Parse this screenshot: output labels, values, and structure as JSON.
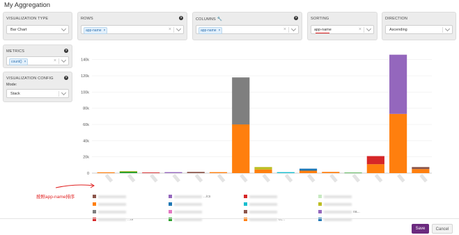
{
  "page": {
    "title": "My Aggregation"
  },
  "viz_type": {
    "label": "VISUALIZATION TYPE",
    "value": "Bar Chart"
  },
  "rows": {
    "label": "ROWS",
    "tag": "app-name"
  },
  "columns": {
    "label": "COLUMNS",
    "tag": "app-name"
  },
  "sorting": {
    "label": "SORTING",
    "value": "app-name"
  },
  "direction": {
    "label": "DIRECTION",
    "value": "Ascending"
  },
  "metrics": {
    "label": "METRICS",
    "tag": "count()"
  },
  "viz_config": {
    "label": "VISUALIZATION CONFIG",
    "mode_label": "Mode:",
    "mode_value": "Stack"
  },
  "annotation": "按照app-name排序",
  "buttons": {
    "save": "Save",
    "cancel": "Cancel"
  },
  "colors": {
    "orange": "#ff7f0e",
    "gray": "#7f7f7f",
    "purple": "#9467bd",
    "red": "#d62728",
    "green": "#2ca02c",
    "blue": "#1f77b4",
    "brown": "#8c564b",
    "olive": "#bcbd22",
    "save": "#6b2a7e",
    "annotation": "#e02020"
  },
  "legend": {
    "items": [
      {
        "color": "#8c564b",
        "text": ""
      },
      {
        "color": "#9467bd",
        "text": "...ics"
      },
      {
        "color": "#d62728",
        "text": ""
      },
      {
        "color": "#c7e9c0",
        "text": ""
      },
      {
        "color": "#ff7f0e",
        "text": ""
      },
      {
        "color": "#1f77b4",
        "text": ""
      },
      {
        "color": "#17becf",
        "text": ""
      },
      {
        "color": "#bcbd22",
        "text": ""
      },
      {
        "color": "#7f7f7f",
        "text": ""
      },
      {
        "color": "#e377c2",
        "text": ""
      },
      {
        "color": "#8c564b",
        "text": ""
      },
      {
        "color": "#9467bd",
        "text": "oa..."
      },
      {
        "color": "#d62728",
        "text": "...or"
      },
      {
        "color": "#2ca02c",
        "text": ""
      },
      {
        "color": "#ff7f0e",
        "text": "cc..."
      },
      {
        "color": "#1f77b4",
        "text": ""
      }
    ]
  },
  "chart_data": {
    "type": "bar",
    "stacked": true,
    "ylim": [
      0,
      150000
    ],
    "yticks": [
      0,
      20000,
      40000,
      60000,
      80000,
      100000,
      120000,
      140000
    ],
    "ytick_labels": [
      "0",
      "20k",
      "40k",
      "60k",
      "80k",
      "100k",
      "120k",
      "140k"
    ],
    "grid": true,
    "bars": [
      [
        {
          "c": "#ff7f0e",
          "v": 1000
        }
      ],
      [
        {
          "c": "#2ca02c",
          "v": 1800
        },
        {
          "c": "#bcbd22",
          "v": 600
        }
      ],
      [
        {
          "c": "#d62728",
          "v": 800
        }
      ],
      [
        {
          "c": "#9467bd",
          "v": 1200
        }
      ],
      [
        {
          "c": "#8c564b",
          "v": 1500
        }
      ],
      [
        {
          "c": "#ff7f0e",
          "v": 1200
        }
      ],
      [
        {
          "c": "#ff7f0e",
          "v": 60000
        },
        {
          "c": "#7f7f7f",
          "v": 58000
        }
      ],
      [
        {
          "c": "#ff7f0e",
          "v": 4500
        },
        {
          "c": "#bcbd22",
          "v": 3000
        }
      ],
      [
        {
          "c": "#17becf",
          "v": 1200
        }
      ],
      [
        {
          "c": "#ff7f0e",
          "v": 3000
        },
        {
          "c": "#1f77b4",
          "v": 2500
        }
      ],
      [
        {
          "c": "#ff7f0e",
          "v": 1500
        }
      ],
      [
        {
          "c": "#2ca02c",
          "v": 600
        }
      ],
      [
        {
          "c": "#ff7f0e",
          "v": 11000
        },
        {
          "c": "#d62728",
          "v": 10000
        }
      ],
      [
        {
          "c": "#ff7f0e",
          "v": 73000
        },
        {
          "c": "#9467bd",
          "v": 73000
        }
      ],
      [
        {
          "c": "#ff7f0e",
          "v": 5000
        },
        {
          "c": "#8c564b",
          "v": 2500
        }
      ]
    ]
  }
}
